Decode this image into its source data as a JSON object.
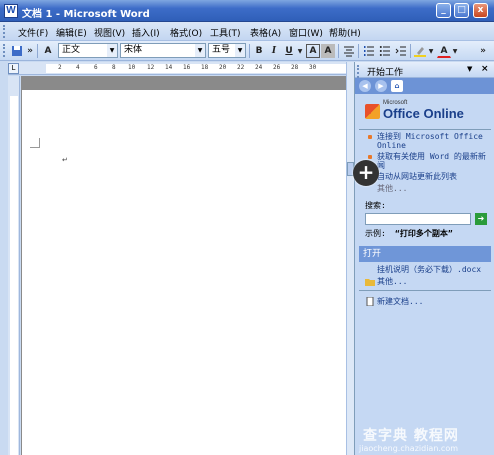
{
  "window": {
    "title": "文档 1 - Microsoft Word",
    "controls": [
      "_",
      "□",
      "x"
    ]
  },
  "menu": {
    "items": [
      "文件(F)",
      "编辑(E)",
      "视图(V)",
      "插入(I)",
      "格式(O)",
      "工具(T)",
      "表格(A)",
      "窗口(W)",
      "帮助(H)"
    ]
  },
  "toolbar": {
    "style": "正文",
    "font": "宋体",
    "size": "五号",
    "bold": "B",
    "italic": "I",
    "underline": "U",
    "char_border": "A",
    "char_shading": "A",
    "font_color": "A",
    "colors": {
      "highlight": "#f0d020",
      "font_color": "#e02020"
    }
  },
  "ruler": {
    "numbers": [
      "2",
      "4",
      "6",
      "8",
      "10",
      "12",
      "14",
      "16",
      "18",
      "20",
      "22",
      "24",
      "26",
      "28",
      "30"
    ],
    "tab_label": "L"
  },
  "document": {
    "pilcrow": "↵"
  },
  "taskpane": {
    "title": "开始工作",
    "brand_small": "Microsoft",
    "brand": "Office Online",
    "links": [
      "连接到 Microsoft Office Online",
      "获取有关使用 Word 的最新新闻",
      "自动从网站更新此列表",
      "其他..."
    ],
    "search_label": "搜索:",
    "search_value": "",
    "example_label": "示例:",
    "example_value": "“打印多个副本”",
    "open_header": "打开",
    "recent_file": "挂机说明（务必下载）.docx",
    "more_files": "其他...",
    "new_doc": "新建文档..."
  },
  "overlay": {
    "plus": "+"
  },
  "watermark": {
    "main": "查字典 教程网",
    "sub": "jiaocheng.chazidian.com"
  }
}
